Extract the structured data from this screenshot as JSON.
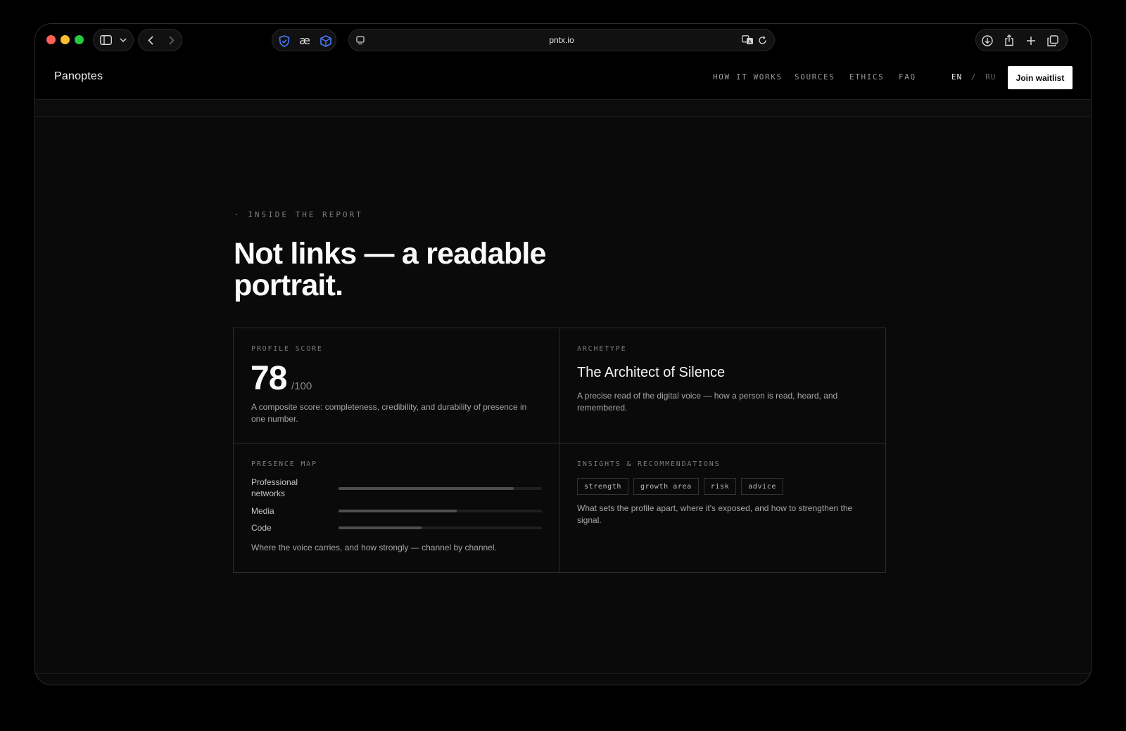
{
  "browser": {
    "url": "pntx.io"
  },
  "site": {
    "logo": "Panoptes",
    "nav": [
      {
        "label": "HOW IT WORKS"
      },
      {
        "label": "SOURCES"
      },
      {
        "label": "ETHICS"
      },
      {
        "label": "FAQ"
      }
    ],
    "lang": {
      "en": "EN",
      "sep": "/",
      "ru": "RU"
    },
    "cta": "Join waitlist"
  },
  "hero": {
    "eyebrow": "· INSIDE THE REPORT",
    "headline": "Not links — a readable portrait."
  },
  "cards": {
    "score": {
      "label": "PROFILE SCORE",
      "value": "78",
      "max": "/100",
      "description": "A composite score: completeness, credibility, and durability of presence in one number."
    },
    "archetype": {
      "label": "ARCHETYPE",
      "title": "The Architect of Silence",
      "description": "A precise read of the digital voice — how a person is read, heard, and remembered."
    },
    "presence": {
      "label": "PRESENCE MAP",
      "rows": [
        {
          "label": "Professional networks",
          "value": 0.86
        },
        {
          "label": "Media",
          "value": 0.58
        },
        {
          "label": "Code",
          "value": 0.41
        }
      ],
      "description": "Where the voice carries, and how strongly — channel by channel."
    },
    "insights": {
      "label": "INSIGHTS & RECOMMENDATIONS",
      "tags": [
        "strength",
        "growth area",
        "risk",
        "advice"
      ],
      "description": "What sets the profile apart, where it's exposed, and how to strengthen the signal."
    }
  },
  "colors": {
    "background": "#0a0a0a",
    "cta_bg": "#ffffff",
    "traffic_red": "#ff5f57",
    "traffic_yellow": "#febc2e",
    "traffic_green": "#28c840"
  }
}
